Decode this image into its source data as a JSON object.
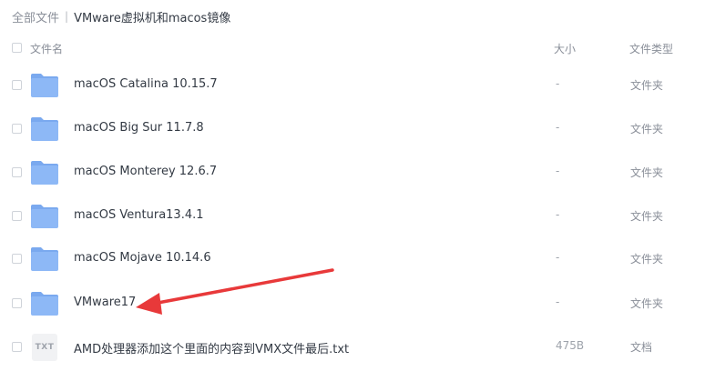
{
  "breadcrumb": {
    "root": "全部文件",
    "separator": "|",
    "current": "VMware虚拟机和macos镜像"
  },
  "header": {
    "name": "文件名",
    "size": "大小",
    "type": "文件类型"
  },
  "files": [
    {
      "name": "macOS Catalina 10.15.7",
      "size": "-",
      "type": "文件夹",
      "icon": "folder-icon"
    },
    {
      "name": "macOS Big Sur 11.7.8",
      "size": "-",
      "type": "文件夹",
      "icon": "folder-icon"
    },
    {
      "name": "macOS Monterey 12.6.7",
      "size": "-",
      "type": "文件夹",
      "icon": "folder-icon"
    },
    {
      "name": "macOS Ventura13.4.1",
      "size": "-",
      "type": "文件夹",
      "icon": "folder-icon"
    },
    {
      "name": "macOS Mojave 10.14.6",
      "size": "-",
      "type": "文件夹",
      "icon": "folder-icon"
    },
    {
      "name": "VMware17",
      "size": "-",
      "type": "文件夹",
      "icon": "folder-icon"
    },
    {
      "name": "AMD处理器添加这个里面的内容到VMX文件最后.txt",
      "size": "475B",
      "type": "文档",
      "icon": "txt-file-icon",
      "icon_label": "TXT"
    }
  ],
  "colors": {
    "folder": "#8db8f6",
    "folder_tab": "#7aa9ef",
    "arrow": "#e8393a"
  }
}
